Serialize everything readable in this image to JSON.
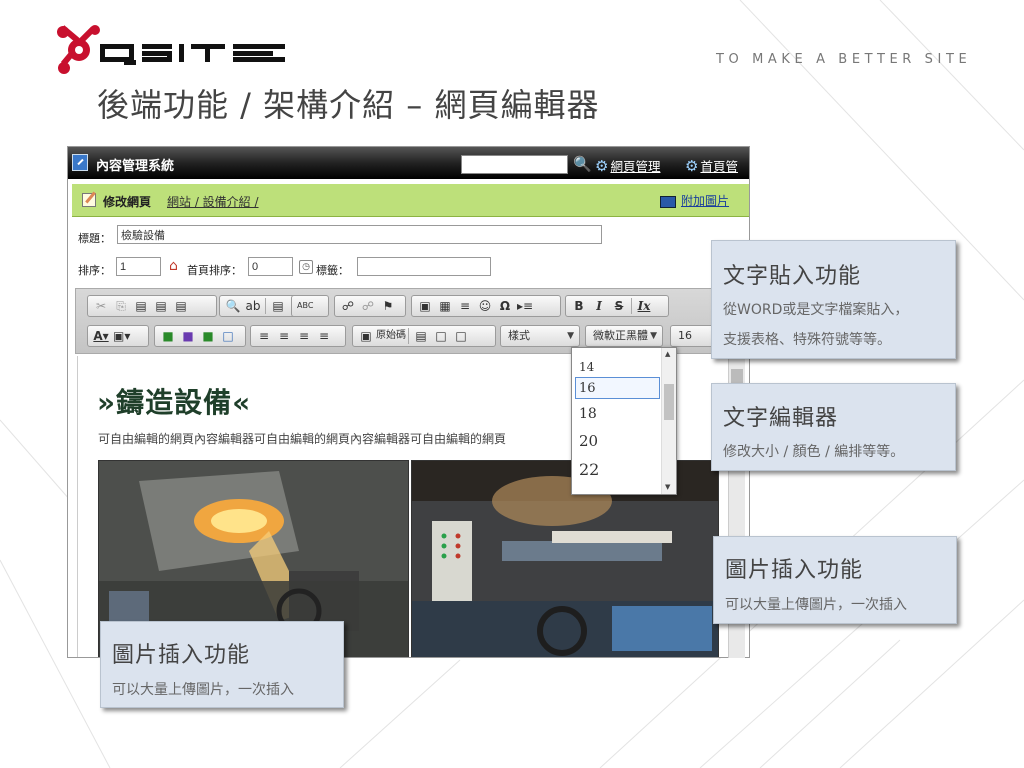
{
  "slide": {
    "brand": "QSITE",
    "tagline": "TO MAKE A BETTER SITE",
    "title": "後端功能 / 架構介紹 – 網頁編輯器"
  },
  "cms": {
    "system_name": "內容管理系統",
    "search_value": "",
    "nav": [
      "網頁管理",
      "首頁管"
    ],
    "edit_title": "修改網頁",
    "breadcrumb": "網站 / 設備介紹 /",
    "attach_image": "附加圖片",
    "title_label": "標題：",
    "title_value": "檢驗設備",
    "sort_label": "排序：",
    "sort_value": "1",
    "home_sort_label": "首頁排序：",
    "home_sort_value": "0",
    "tag_label": "標籤：",
    "tag_value": ""
  },
  "toolbar": {
    "row1": [
      "✂",
      "⎘",
      "📋",
      "📋",
      "📋",
      "🔍",
      "ab",
      "❙",
      "ABC",
      "🔗",
      "⛓",
      "⚑",
      "🖼",
      "▦",
      "≡",
      "☺",
      "Ω",
      "▸≡",
      "B",
      "I",
      "S",
      "Ix"
    ],
    "style_combo": "樣式",
    "font_combo": "微軟正黑體",
    "size_combo": "16",
    "source_label": "原始碼"
  },
  "font_size_dropdown": {
    "options": [
      "14",
      "16",
      "18",
      "20",
      "22"
    ],
    "selected": "16"
  },
  "document": {
    "heading": "»鑄造設備«",
    "body": "可自由編輯的網頁內容編輯器可自由編輯的網頁內容編輯器可自由編輯的網頁"
  },
  "callouts": [
    {
      "title": "文字貼入功能",
      "desc": [
        "從WORD或是文字檔案貼入，",
        "支援表格、特殊符號等等。"
      ]
    },
    {
      "title": "文字編輯器",
      "desc": [
        "修改大小 / 顏色 / 編排等等。"
      ]
    },
    {
      "title": "圖片插入功能",
      "desc": [
        "可以大量上傳圖片，一次插入"
      ]
    },
    {
      "title": "圖片插入功能",
      "desc": [
        "可以大量上傳圖片，一次插入"
      ]
    }
  ],
  "colors": {
    "brand_red": "#c8102e",
    "edit_bar_green": "#bde07a",
    "callout_bg": "#dbe3ee",
    "cms_bar": "#1a1a1a"
  }
}
